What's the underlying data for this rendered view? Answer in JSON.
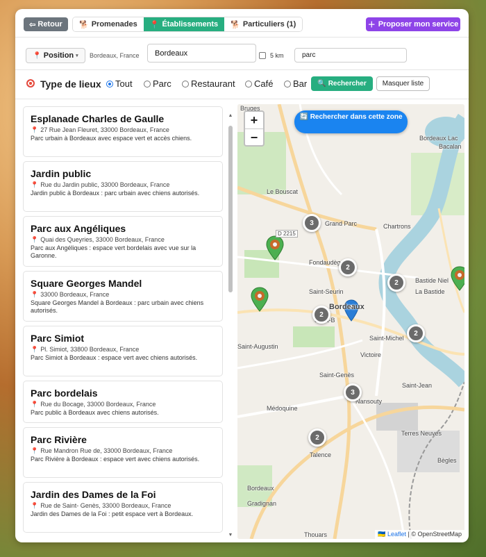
{
  "nav": {
    "back_label": "Retour",
    "tabs": [
      {
        "label": "Promenades",
        "icon": "🐕"
      },
      {
        "label": "Établissements",
        "icon": "📍"
      },
      {
        "label": "Particuliers (1)",
        "icon": "🐕"
      }
    ],
    "propose_label": "Proposer mon service"
  },
  "location": {
    "position_label": "Position",
    "location_text": "Bordeaux, France",
    "city_value": "Bordeaux",
    "radius_label": "5 km",
    "keyword_value": "parc"
  },
  "filters": {
    "title": "Type de lieux",
    "options": [
      "Tout",
      "Parc",
      "Restaurant",
      "Café",
      "Bar"
    ],
    "selected": "Tout",
    "search_label": "Rechercher",
    "hide_list_label": "Masquer liste"
  },
  "results": [
    {
      "title": "Esplanade Charles de Gaulle",
      "address": "27 Rue Jean Fleuret, 33000 Bordeaux, France",
      "description": "Parc urbain à Bordeaux avec espace vert et accès chiens."
    },
    {
      "title": "Jardin public",
      "address": "Rue du Jardin public, 33000 Bordeaux, France",
      "description": "Jardin public à Bordeaux : parc urbain avec chiens autorisés."
    },
    {
      "title": "Parc aux Angéliques",
      "address": "Quai des Queyries, 33000 Bordeaux, France",
      "description": "Parc aux Angéliques : espace vert bordelais avec vue sur la Garonne."
    },
    {
      "title": "Square Georges Mandel",
      "address": "33000 Bordeaux, France",
      "description": "Square Georges Mandel à Bordeaux : parc urbain avec chiens autorisés."
    },
    {
      "title": "Parc Simiot",
      "address": "Pl. Simiot, 33800 Bordeaux, France",
      "description": "Parc Simiot à Bordeaux : espace vert avec chiens autorisés."
    },
    {
      "title": "Parc bordelais",
      "address": "Rue du Bocage, 33000 Bordeaux, France",
      "description": "Parc public à Bordeaux avec chiens autorisés."
    },
    {
      "title": "Parc Rivière",
      "address": "Rue Mandron Rue de, 33000 Bordeaux, France",
      "description": "Parc Rivière à Bordeaux : espace vert avec chiens autorisés."
    },
    {
      "title": "Jardin des Dames de la Foi",
      "address": "Rue de Saint- Genès, 33000 Bordeaux, France",
      "description": "Jardin des Dames de la Foi : petit espace vert à Bordeaux."
    }
  ],
  "map": {
    "zoom_in": "+",
    "zoom_out": "−",
    "search_area_label": "🔄 Rechercher dans cette zone",
    "clusters": [
      "3",
      "2",
      "2",
      "2",
      "2",
      "3",
      "2"
    ],
    "places": [
      "Bruges",
      "Bordeaux Lac",
      "Bacalan",
      "Le Bouscat",
      "Grand Parc",
      "Chartrons",
      "Fondaudège",
      "Bastide Niel",
      "La Bastide",
      "Saint-Seurin",
      "Bordeaux",
      "Saint-B",
      "Saint-Augustin",
      "Saint-Michel",
      "Victoire",
      "Saint-Genès",
      "Saint-Jean",
      "Nansouty",
      "Médoquine",
      "Terres Neuves",
      "Talence",
      "Bègles",
      "Thouars",
      "Gradignan",
      "Bordeaux"
    ],
    "road_badge": "D 2215",
    "attribution_link": "Leaflet",
    "attribution_text": "| © OpenStreetMap",
    "attribution_flag": "🇺🇦"
  },
  "colors": {
    "accent_green": "#27ae80",
    "accent_purple": "#8e44e8",
    "back_gray": "#6c757d",
    "map_blue": "#1a84f0"
  }
}
